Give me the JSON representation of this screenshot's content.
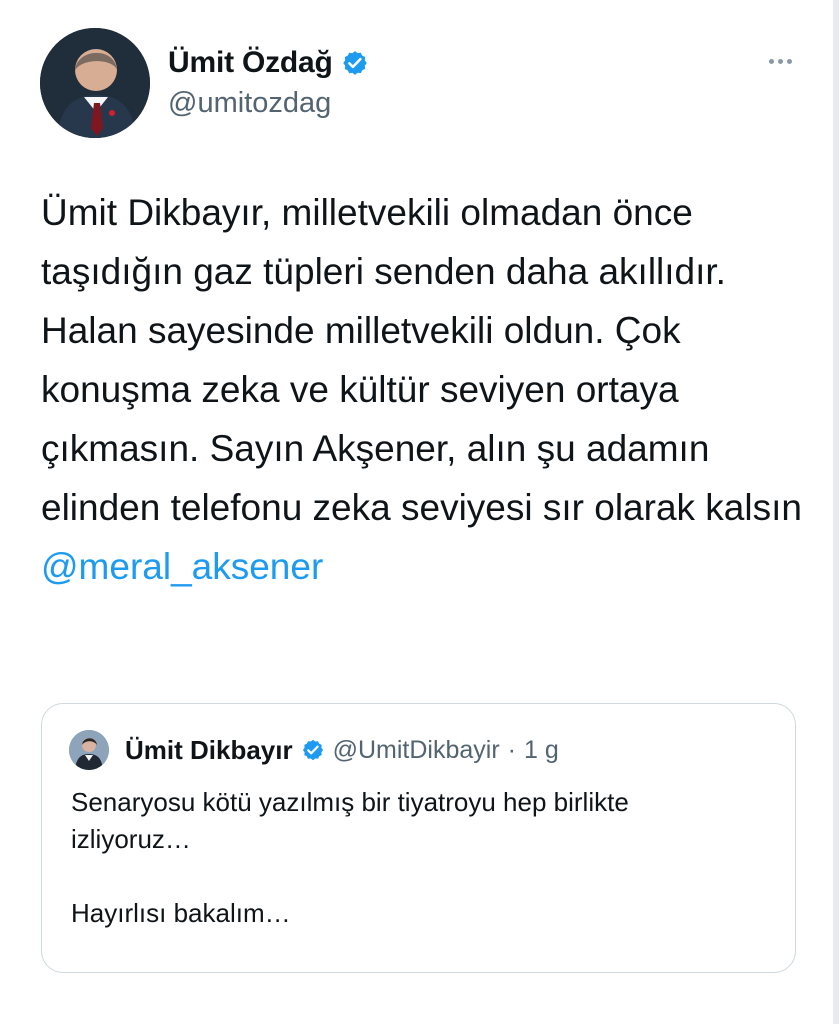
{
  "tweet": {
    "author": {
      "display_name": "Ümit Özdağ",
      "handle": "@umitozdag",
      "verified_icon": "verified-badge-icon",
      "avatar_icon": "person-avatar"
    },
    "more_icon": "more-horizontal-icon",
    "body": "Ümit Dikbayır, milletvekili olmadan önce taşıdığın gaz tüpleri senden daha akıllıdır. Halan sayesinde milletvekili oldun. Çok konuşma zeka ve kültür seviyen ortaya çıkmasın. Sayın Akşener, alın şu adamın elinden telefonu zeka seviyesi sır olarak kalsın",
    "mention": "@meral_aksener"
  },
  "quote_tweet": {
    "author": {
      "display_name": "Ümit Dikbayır",
      "handle": "@UmitDikbayir",
      "verified_icon": "verified-badge-icon",
      "avatar_icon": "person-avatar"
    },
    "separator": "·",
    "time": "1 g",
    "body": "Senaryosu kötü yazılmış bir tiyatroyu hep birlikte\nizliyoruz…\n\nHayırlısı bakalım…"
  },
  "colors": {
    "text": "#0f1419",
    "muted": "#536471",
    "link": "#1d9bf0",
    "verified": "#1d9bf0",
    "border": "#cfd9de"
  }
}
